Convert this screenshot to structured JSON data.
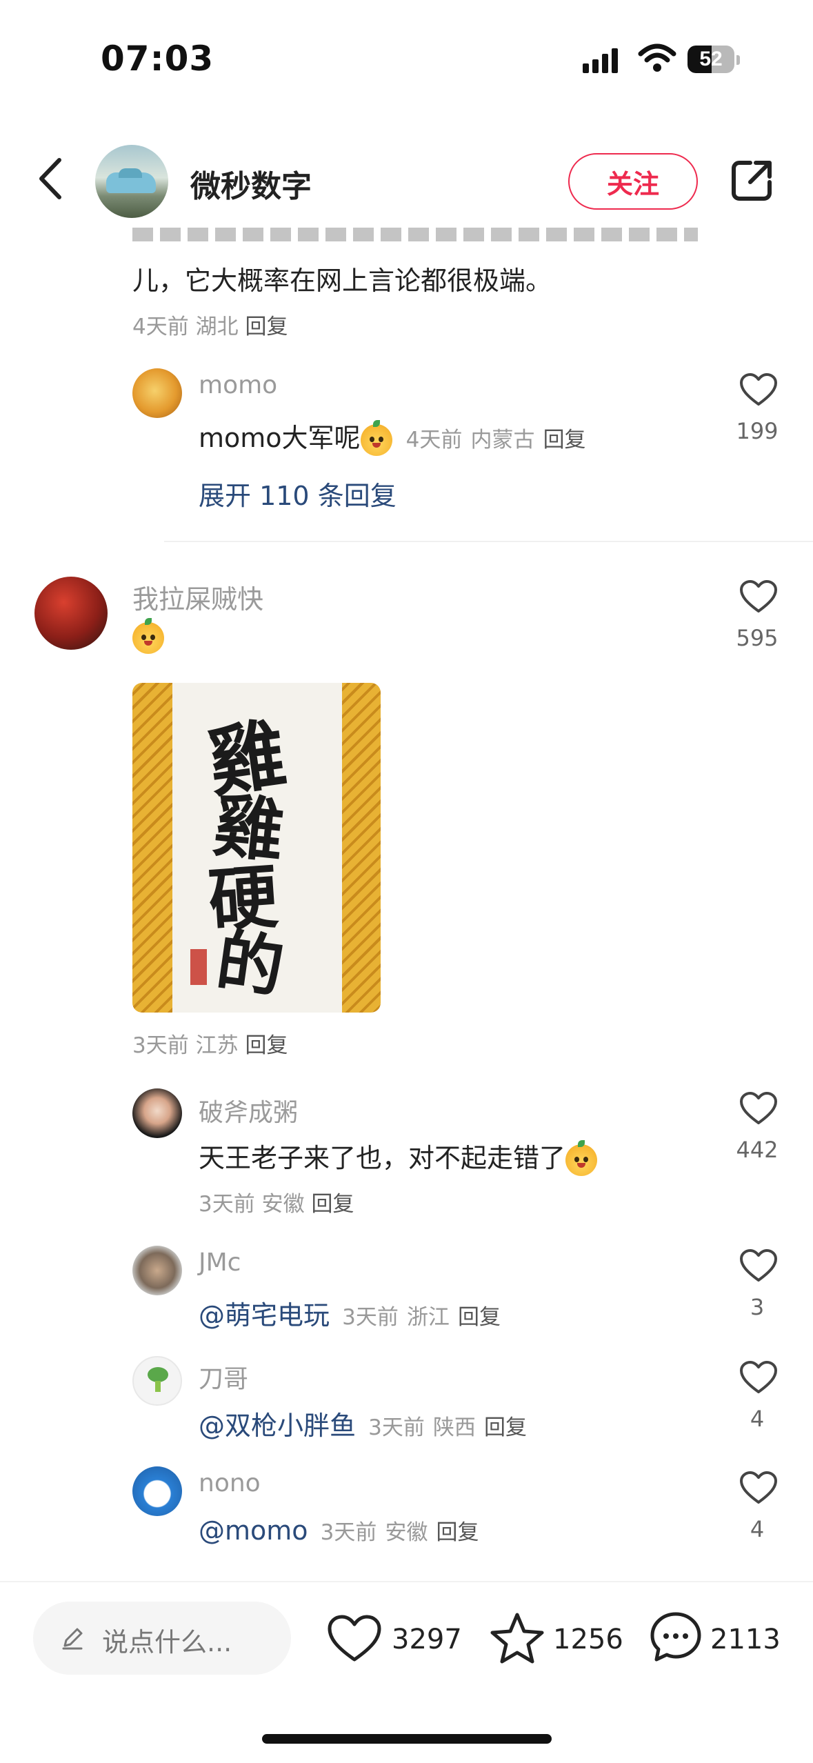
{
  "status_bar": {
    "time": "07:03",
    "battery": "52",
    "battery_level_percent": 52
  },
  "header": {
    "title": "微秒数字",
    "follow_label": "关注"
  },
  "partial_comment": {
    "text_line": "儿，它大概率在网上言论都很极端。",
    "meta": {
      "time": "4天前",
      "location": "湖北",
      "reply": "回复"
    }
  },
  "reply_momo": {
    "name": "momo",
    "text": "momo大军呢",
    "meta": {
      "time": "4天前",
      "location": "内蒙古",
      "reply": "回复"
    },
    "likes": "199",
    "expand": "展开 110 条回复"
  },
  "main_comment": {
    "name": "我拉屎贼快",
    "likes": "595",
    "meta": {
      "time": "3天前",
      "location": "江苏",
      "reply": "回复"
    }
  },
  "replies": [
    {
      "name": "破斧成粥",
      "text": "天王老子来了也，对不起走错了",
      "time": "3天前",
      "location": "安徽",
      "reply": "回复",
      "likes": "442"
    },
    {
      "name": "JMc",
      "mention": "@萌宅电玩",
      "time": "3天前",
      "location": "浙江",
      "reply": "回复",
      "likes": "3"
    },
    {
      "name": "刀哥",
      "mention": "@双枪小胖鱼",
      "time": "3天前",
      "location": "陕西",
      "reply": "回复",
      "likes": "4"
    },
    {
      "name": "nono",
      "mention": "@momo",
      "time": "3天前",
      "location": "安徽",
      "reply": "回复",
      "likes": "4"
    }
  ],
  "bottom_bar": {
    "input_placeholder": "说点什么...",
    "likes": "3297",
    "favorites": "1256",
    "comments": "2113"
  },
  "colors": {
    "accent": "#ee2a4e",
    "link": "#2a4a7a"
  },
  "icons": [
    "back-icon",
    "share-icon",
    "heart-icon",
    "star-icon",
    "comment-icon",
    "pen-icon",
    "emoji-icon"
  ]
}
